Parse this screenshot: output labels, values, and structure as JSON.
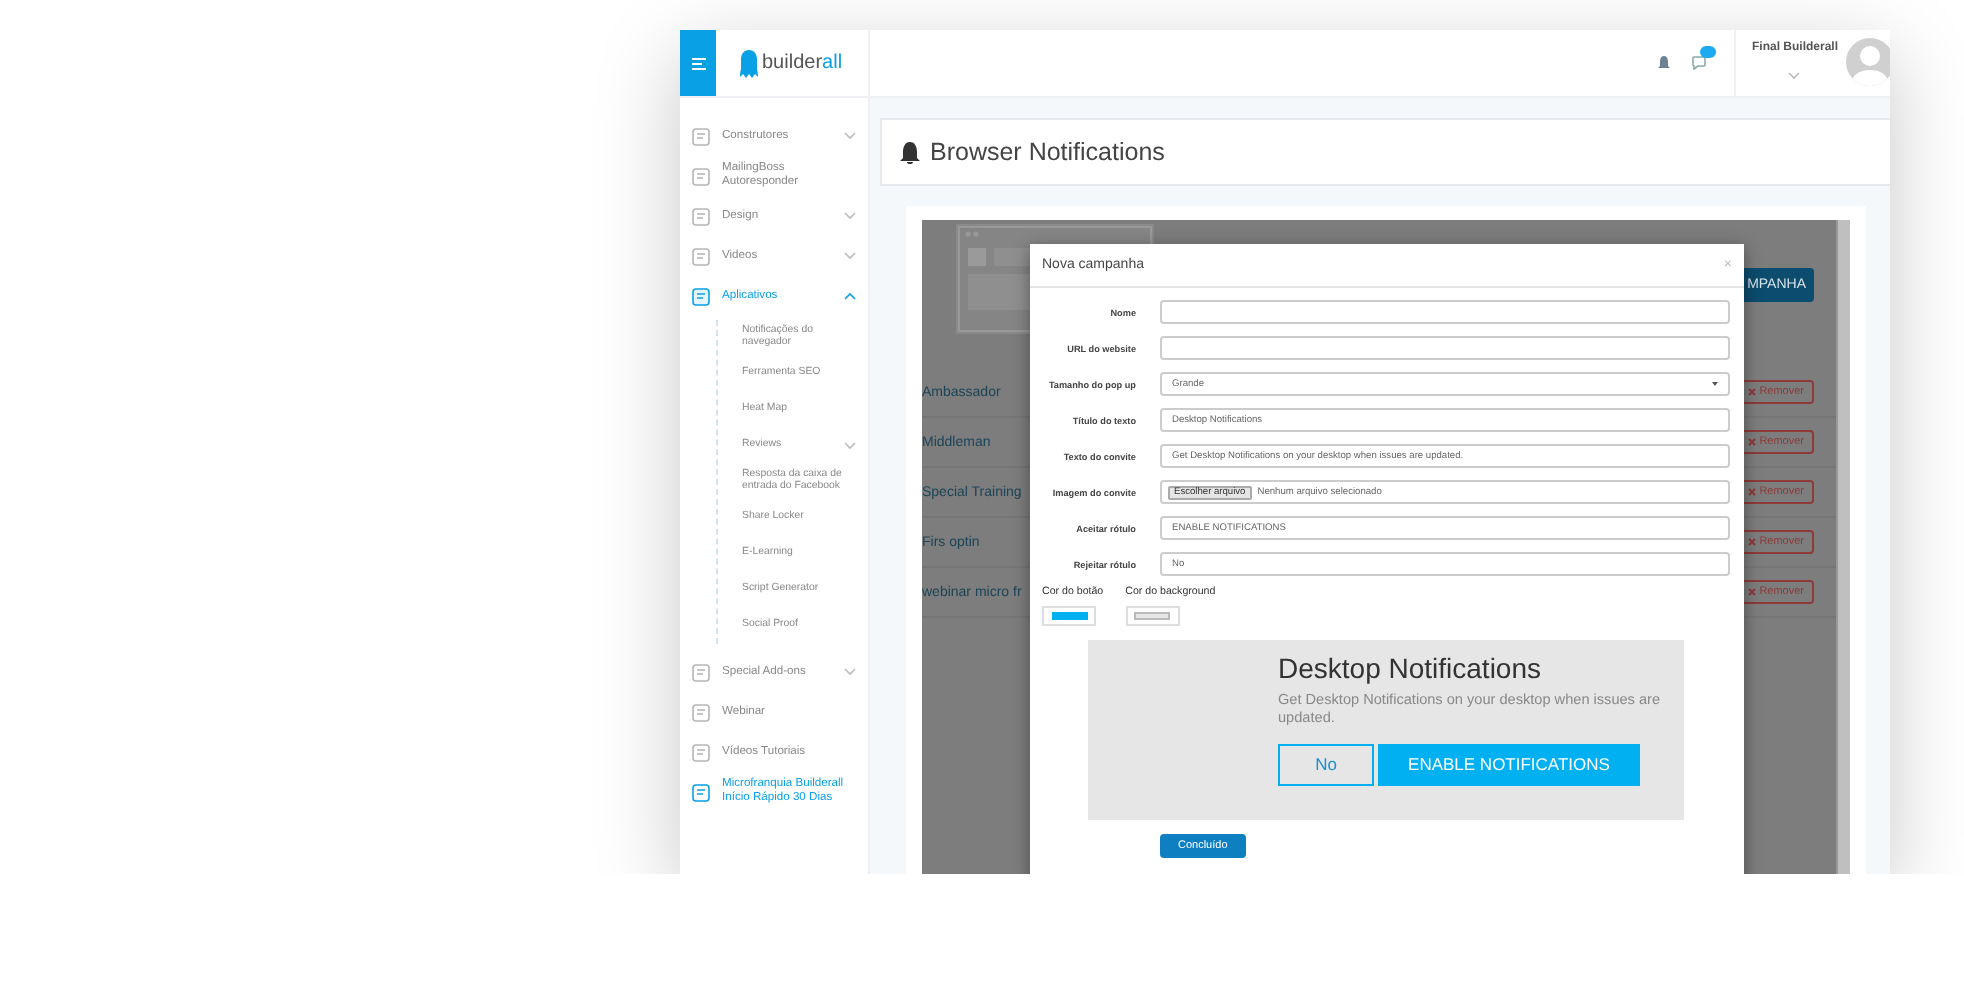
{
  "sidebar": {
    "logo": {
      "main": "builder",
      "accent": "all"
    },
    "items": [
      {
        "label": "Construtores",
        "selected": false,
        "expanded": false
      },
      {
        "label": "MailingBoss Autoresponder",
        "selected": false
      },
      {
        "label": "Design",
        "selected": false,
        "expanded": false
      },
      {
        "label": "Videos",
        "selected": false,
        "expanded": false
      },
      {
        "label": "Aplicativos",
        "selected": true,
        "expanded": true,
        "children": [
          {
            "label": "Notificações do navegador"
          },
          {
            "label": "Ferramenta SEO"
          },
          {
            "label": "Heat Map"
          },
          {
            "label": "Reviews",
            "expanded": false
          },
          {
            "label": "Resposta da caixa de entrada do Facebook"
          },
          {
            "label": "Share Locker"
          },
          {
            "label": "E-Learning"
          },
          {
            "label": "Script Generator"
          },
          {
            "label": "Social Proof"
          }
        ]
      },
      {
        "label": "Special Add-ons",
        "selected": false,
        "expanded": false
      },
      {
        "label": "Webinar",
        "selected": false
      },
      {
        "label": "Vídeos Tutoriais",
        "selected": false
      },
      {
        "label": "Microfranquia Builderall Início Rápido 30 Dias",
        "selected": false,
        "kind": "highlight"
      }
    ]
  },
  "header": {
    "user_name": "Final Builderall"
  },
  "page_title": "Browser Notifications",
  "background": {
    "button": "MPANHA",
    "rows": [
      {
        "label": "Ambassador",
        "action": "Remover"
      },
      {
        "label": "Middleman",
        "action": "Remover"
      },
      {
        "label": "Special Training",
        "action": "Remover"
      },
      {
        "label": "Firs optin",
        "action": "Remover"
      },
      {
        "label": "webinar micro fr",
        "action": "Remover"
      }
    ]
  },
  "modal": {
    "title": "Nova campanha",
    "close": "×",
    "fields": [
      {
        "label": "Nome",
        "kind": "text"
      },
      {
        "label": "URL do website",
        "kind": "text"
      },
      {
        "label": "Tamanho do pop up",
        "kind": "select",
        "value": "Grande"
      },
      {
        "label": "Título do texto",
        "kind": "text",
        "value": "Desktop Notifications"
      },
      {
        "label": "Texto do convite",
        "kind": "text",
        "value": "Get Desktop Notifications on your desktop when issues are updated."
      },
      {
        "label": "Imagem do convite",
        "kind": "file",
        "button": "Escolher arquivo",
        "value": "Nenhum arquivo selecionado"
      },
      {
        "label": "Aceitar rótulo",
        "kind": "text",
        "value": "ENABLE NOTIFICATIONS"
      },
      {
        "label": "Rejeitar rótulo",
        "kind": "text",
        "value": "No"
      }
    ],
    "colors": [
      {
        "label": "Cor do botão",
        "color": "#00b0f0"
      },
      {
        "label": "Cor do background",
        "color": "#e6e6e6"
      }
    ],
    "preview": {
      "title": "Desktop Notifications",
      "text": "Get Desktop Notifications on your desktop when issues are updated.",
      "reject": "No",
      "accept": "ENABLE NOTIFICATIONS"
    },
    "submit": "Concluído"
  }
}
